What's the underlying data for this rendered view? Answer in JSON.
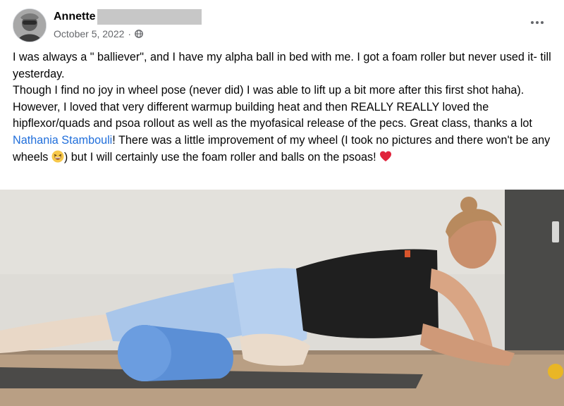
{
  "post": {
    "author_name": "Annette",
    "date": "October 5, 2022",
    "separator": "·",
    "privacy_icon": "globe-icon",
    "more_icon": "more-options-icon",
    "text": {
      "line1": "I was always a \" balliever\", and I have my alpha ball in bed with me. I got a foam roller but never used it- till yesterday.",
      "line2_a": "Though I find no joy in wheel pose (never did) I was able to lift up a bit more after this first shot haha).  However, I loved that very different warmup building heat and then REALLY REALLY loved the hipflexor/quads and psoa rollout as well as the myofasical release of the pecs. Great class, thanks a lot ",
      "mention": "Nathania Stambouli",
      "line2_b": "! There was a little improvement of my wheel (I took no pictures and there won't be any wheels ",
      "line2_c": ") but I will certainly use the foam roller and balls on the psoas! ",
      "emoji_laugh": "grinning-squinting-face-emoji",
      "emoji_heart": "red-heart-emoji"
    },
    "photo": {
      "description_icon": "post-photo",
      "accent_colors": {
        "mat": "#4a4a4a",
        "roller": "#5b8fd6",
        "tights": "#a9c6ea",
        "top": "#1f1f1f",
        "floor": "#b89c80"
      }
    }
  },
  "colors": {
    "text": "#050505",
    "meta": "#65676b",
    "link": "#216fdb"
  }
}
